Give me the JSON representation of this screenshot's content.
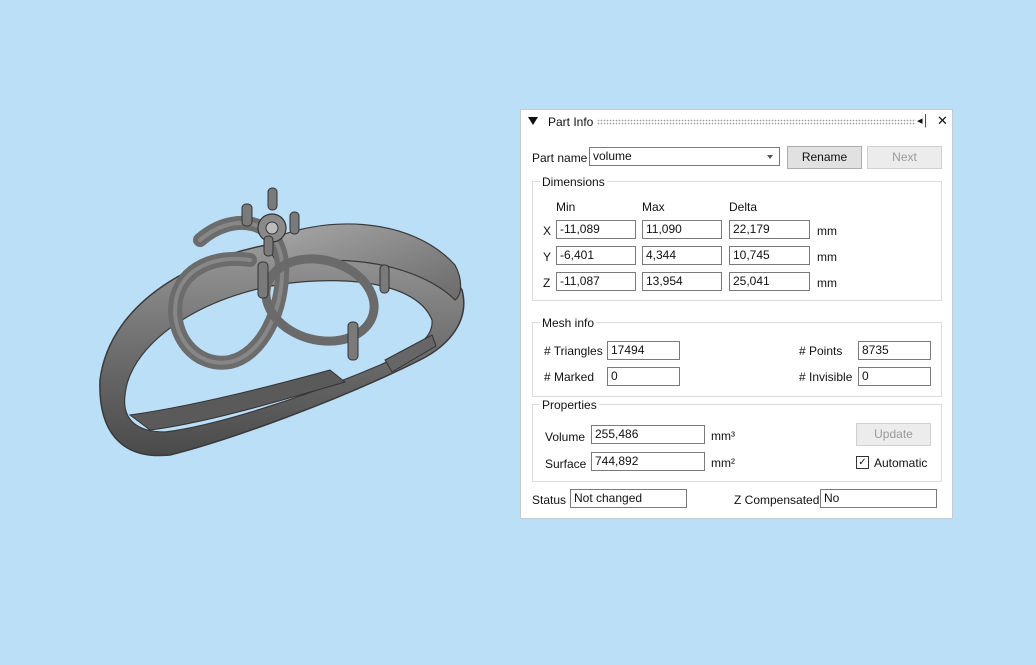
{
  "panel": {
    "title": "Part Info",
    "part_name_label": "Part name",
    "part_name_value": "volume",
    "rename_label": "Rename",
    "next_label": "Next",
    "dimensions": {
      "title": "Dimensions",
      "col_min": "Min",
      "col_max": "Max",
      "col_delta": "Delta",
      "rows": [
        {
          "axis": "X",
          "min": "-11,089",
          "max": "11,090",
          "delta": "22,179",
          "unit": "mm"
        },
        {
          "axis": "Y",
          "min": "-6,401",
          "max": "4,344",
          "delta": "10,745",
          "unit": "mm"
        },
        {
          "axis": "Z",
          "min": "-11,087",
          "max": "13,954",
          "delta": "25,041",
          "unit": "mm"
        }
      ]
    },
    "mesh": {
      "title": "Mesh info",
      "triangles_label": "# Triangles",
      "triangles_value": "17494",
      "points_label": "# Points",
      "points_value": "8735",
      "marked_label": "# Marked",
      "marked_value": "0",
      "invisible_label": "# Invisible",
      "invisible_value": "0"
    },
    "properties": {
      "title": "Properties",
      "volume_label": "Volume",
      "volume_value": "255,486",
      "volume_unit": "mm³",
      "surface_label": "Surface",
      "surface_value": "744,892",
      "surface_unit": "mm²",
      "update_label": "Update",
      "automatic_label": "Automatic",
      "automatic_checked": true
    },
    "status_label": "Status",
    "status_value": "Not changed",
    "zcomp_label": "Z Compensated",
    "zcomp_value": "No"
  },
  "icons": {
    "collapse": "collapse-triangle-icon",
    "pin": "pin-icon",
    "close": "close-icon",
    "model": "ring-model"
  },
  "colors": {
    "background": "#bcdff8",
    "model": "#7b7b7b",
    "panel": "#ffffff"
  }
}
